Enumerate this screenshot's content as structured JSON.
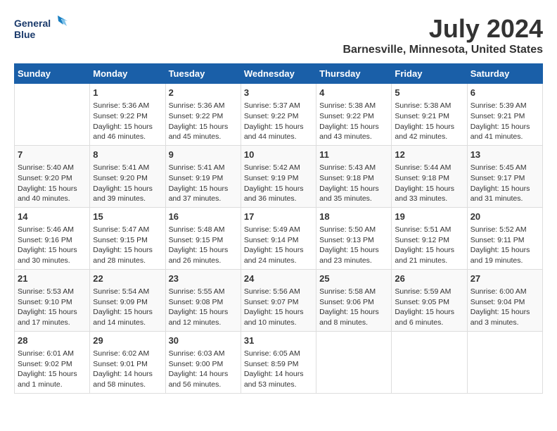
{
  "header": {
    "logo_line1": "General",
    "logo_line2": "Blue",
    "month": "July 2024",
    "location": "Barnesville, Minnesota, United States"
  },
  "days_of_week": [
    "Sunday",
    "Monday",
    "Tuesday",
    "Wednesday",
    "Thursday",
    "Friday",
    "Saturday"
  ],
  "weeks": [
    [
      {
        "day": "",
        "info": ""
      },
      {
        "day": "1",
        "info": "Sunrise: 5:36 AM\nSunset: 9:22 PM\nDaylight: 15 hours\nand 46 minutes."
      },
      {
        "day": "2",
        "info": "Sunrise: 5:36 AM\nSunset: 9:22 PM\nDaylight: 15 hours\nand 45 minutes."
      },
      {
        "day": "3",
        "info": "Sunrise: 5:37 AM\nSunset: 9:22 PM\nDaylight: 15 hours\nand 44 minutes."
      },
      {
        "day": "4",
        "info": "Sunrise: 5:38 AM\nSunset: 9:22 PM\nDaylight: 15 hours\nand 43 minutes."
      },
      {
        "day": "5",
        "info": "Sunrise: 5:38 AM\nSunset: 9:21 PM\nDaylight: 15 hours\nand 42 minutes."
      },
      {
        "day": "6",
        "info": "Sunrise: 5:39 AM\nSunset: 9:21 PM\nDaylight: 15 hours\nand 41 minutes."
      }
    ],
    [
      {
        "day": "7",
        "info": "Sunrise: 5:40 AM\nSunset: 9:20 PM\nDaylight: 15 hours\nand 40 minutes."
      },
      {
        "day": "8",
        "info": "Sunrise: 5:41 AM\nSunset: 9:20 PM\nDaylight: 15 hours\nand 39 minutes."
      },
      {
        "day": "9",
        "info": "Sunrise: 5:41 AM\nSunset: 9:19 PM\nDaylight: 15 hours\nand 37 minutes."
      },
      {
        "day": "10",
        "info": "Sunrise: 5:42 AM\nSunset: 9:19 PM\nDaylight: 15 hours\nand 36 minutes."
      },
      {
        "day": "11",
        "info": "Sunrise: 5:43 AM\nSunset: 9:18 PM\nDaylight: 15 hours\nand 35 minutes."
      },
      {
        "day": "12",
        "info": "Sunrise: 5:44 AM\nSunset: 9:18 PM\nDaylight: 15 hours\nand 33 minutes."
      },
      {
        "day": "13",
        "info": "Sunrise: 5:45 AM\nSunset: 9:17 PM\nDaylight: 15 hours\nand 31 minutes."
      }
    ],
    [
      {
        "day": "14",
        "info": "Sunrise: 5:46 AM\nSunset: 9:16 PM\nDaylight: 15 hours\nand 30 minutes."
      },
      {
        "day": "15",
        "info": "Sunrise: 5:47 AM\nSunset: 9:15 PM\nDaylight: 15 hours\nand 28 minutes."
      },
      {
        "day": "16",
        "info": "Sunrise: 5:48 AM\nSunset: 9:15 PM\nDaylight: 15 hours\nand 26 minutes."
      },
      {
        "day": "17",
        "info": "Sunrise: 5:49 AM\nSunset: 9:14 PM\nDaylight: 15 hours\nand 24 minutes."
      },
      {
        "day": "18",
        "info": "Sunrise: 5:50 AM\nSunset: 9:13 PM\nDaylight: 15 hours\nand 23 minutes."
      },
      {
        "day": "19",
        "info": "Sunrise: 5:51 AM\nSunset: 9:12 PM\nDaylight: 15 hours\nand 21 minutes."
      },
      {
        "day": "20",
        "info": "Sunrise: 5:52 AM\nSunset: 9:11 PM\nDaylight: 15 hours\nand 19 minutes."
      }
    ],
    [
      {
        "day": "21",
        "info": "Sunrise: 5:53 AM\nSunset: 9:10 PM\nDaylight: 15 hours\nand 17 minutes."
      },
      {
        "day": "22",
        "info": "Sunrise: 5:54 AM\nSunset: 9:09 PM\nDaylight: 15 hours\nand 14 minutes."
      },
      {
        "day": "23",
        "info": "Sunrise: 5:55 AM\nSunset: 9:08 PM\nDaylight: 15 hours\nand 12 minutes."
      },
      {
        "day": "24",
        "info": "Sunrise: 5:56 AM\nSunset: 9:07 PM\nDaylight: 15 hours\nand 10 minutes."
      },
      {
        "day": "25",
        "info": "Sunrise: 5:58 AM\nSunset: 9:06 PM\nDaylight: 15 hours\nand 8 minutes."
      },
      {
        "day": "26",
        "info": "Sunrise: 5:59 AM\nSunset: 9:05 PM\nDaylight: 15 hours\nand 6 minutes."
      },
      {
        "day": "27",
        "info": "Sunrise: 6:00 AM\nSunset: 9:04 PM\nDaylight: 15 hours\nand 3 minutes."
      }
    ],
    [
      {
        "day": "28",
        "info": "Sunrise: 6:01 AM\nSunset: 9:02 PM\nDaylight: 15 hours\nand 1 minute."
      },
      {
        "day": "29",
        "info": "Sunrise: 6:02 AM\nSunset: 9:01 PM\nDaylight: 14 hours\nand 58 minutes."
      },
      {
        "day": "30",
        "info": "Sunrise: 6:03 AM\nSunset: 9:00 PM\nDaylight: 14 hours\nand 56 minutes."
      },
      {
        "day": "31",
        "info": "Sunrise: 6:05 AM\nSunset: 8:59 PM\nDaylight: 14 hours\nand 53 minutes."
      },
      {
        "day": "",
        "info": ""
      },
      {
        "day": "",
        "info": ""
      },
      {
        "day": "",
        "info": ""
      }
    ]
  ]
}
